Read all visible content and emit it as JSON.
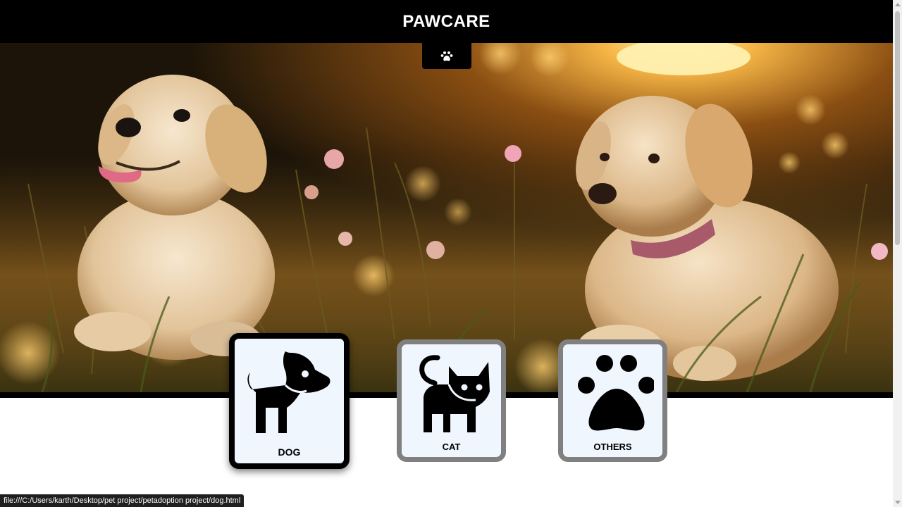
{
  "header": {
    "title": "PAWCARE"
  },
  "hero": {
    "image": "two-golden-puppies-in-sunset-meadow",
    "nav_icon": "paw-icon"
  },
  "categories": [
    {
      "label": "DOG",
      "icon": "dog-icon",
      "state": "hovered"
    },
    {
      "label": "CAT",
      "icon": "cat-icon",
      "state": "normal"
    },
    {
      "label": "OTHERS",
      "icon": "paw-print-icon",
      "state": "normal"
    }
  ],
  "status_bar": {
    "url": "file:///C:/Users/karth/Desktop/pet project/petadoption project/dog.html"
  },
  "colors": {
    "header_bg": "#000000",
    "card_bg": "#f0f6fd",
    "card_border_active": "#000000",
    "card_border": "#808080"
  }
}
